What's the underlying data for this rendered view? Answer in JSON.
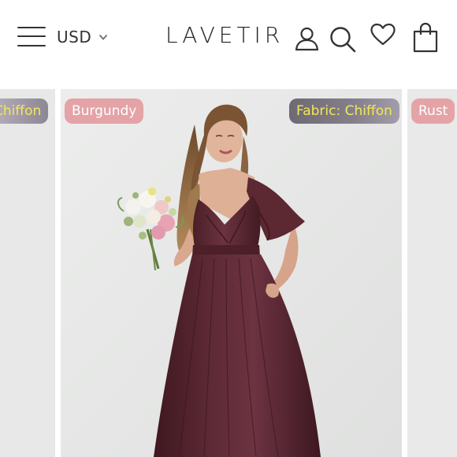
{
  "header": {
    "currency": "USD",
    "logo": "LAVETIR",
    "icons": [
      "menu-icon",
      "chevron-down-icon",
      "account-icon",
      "search-icon",
      "heart-icon",
      "shopping-bag-icon"
    ]
  },
  "gallery": {
    "left_card": {
      "tag": "Chiffon"
    },
    "main_card": {
      "color_tag": "Burgundy",
      "fabric_tag": "Fabric: Chiffon"
    },
    "right_card": {
      "tag": "Rust"
    }
  },
  "colors": {
    "dress": "#5a2a33",
    "pink_tag": "#e4a3a6",
    "fabric_tag_text": "#f3e857",
    "background": "#e6e7e6"
  }
}
